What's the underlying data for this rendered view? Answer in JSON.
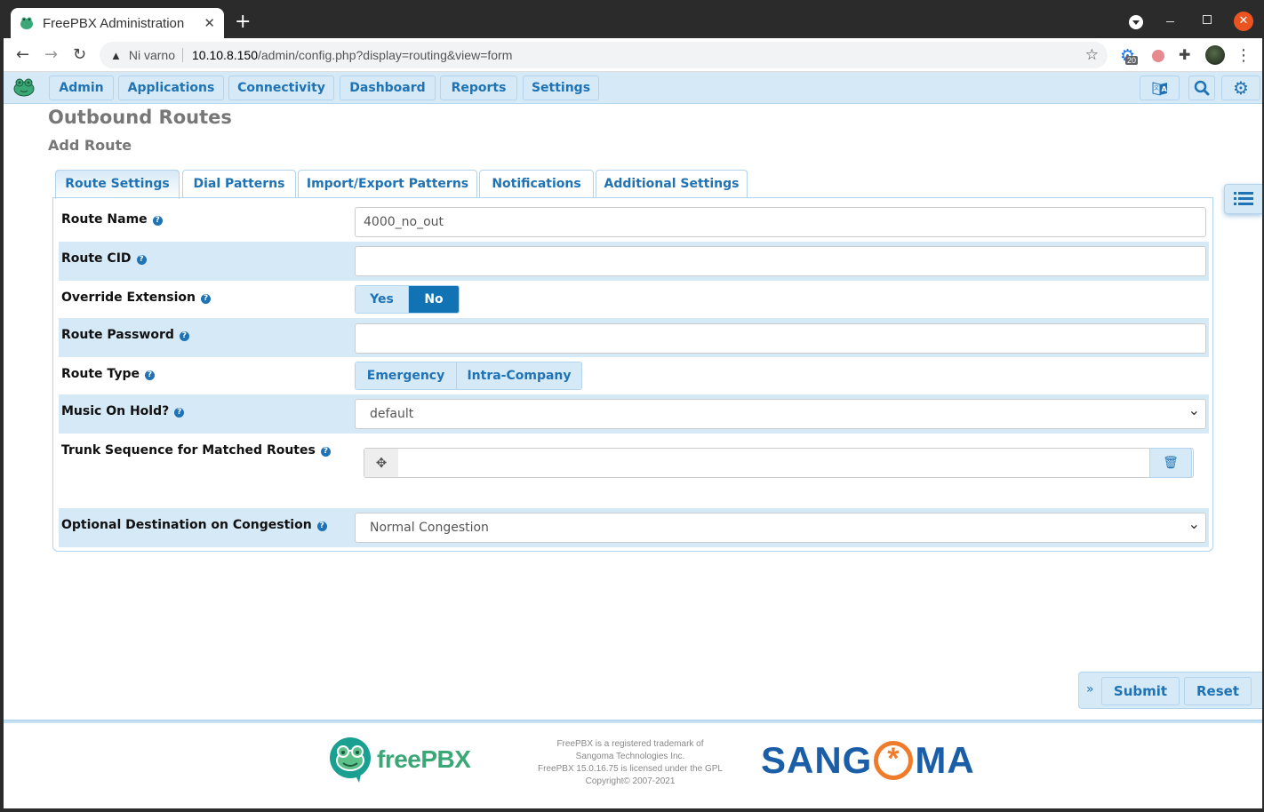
{
  "browser": {
    "tab_title": "FreePBX Administration",
    "security_label": "Ni varno",
    "url_host": "10.10.8.150",
    "url_path": "/admin/config.php?display=routing&view=form",
    "extension_badge": "20"
  },
  "nav": {
    "items": [
      {
        "label": "Admin"
      },
      {
        "label": "Applications"
      },
      {
        "label": "Connectivity"
      },
      {
        "label": "Dashboard"
      },
      {
        "label": "Reports"
      },
      {
        "label": "Settings"
      }
    ]
  },
  "page": {
    "title": "Outbound Routes",
    "subtitle": "Add Route"
  },
  "tabs": [
    {
      "label": "Route Settings",
      "active": true
    },
    {
      "label": "Dial Patterns"
    },
    {
      "label": "Import/Export Patterns"
    },
    {
      "label": "Notifications"
    },
    {
      "label": "Additional Settings"
    }
  ],
  "form": {
    "route_name": {
      "label": "Route Name",
      "value": "4000_no_out"
    },
    "route_cid": {
      "label": "Route CID",
      "value": ""
    },
    "override_extension": {
      "label": "Override Extension",
      "options": [
        "Yes",
        "No"
      ],
      "selected": "No"
    },
    "route_password": {
      "label": "Route Password",
      "value": ""
    },
    "route_type": {
      "label": "Route Type",
      "options": [
        "Emergency",
        "Intra-Company"
      ]
    },
    "music_on_hold": {
      "label": "Music On Hold?",
      "value": "default"
    },
    "trunk_sequence": {
      "label": "Trunk Sequence for Matched Routes",
      "value": ""
    },
    "congestion_destination": {
      "label": "Optional Destination on Congestion",
      "value": "Normal Congestion"
    }
  },
  "actions": {
    "submit": "Submit",
    "reset": "Reset"
  },
  "footer": {
    "logo_text": "freePBX",
    "line1": "FreePBX is a registered trademark of",
    "line2": "Sangoma Technologies Inc.",
    "line3": "FreePBX 15.0.16.75 is licensed under the GPL",
    "line4": "Copyright© 2007-2021",
    "sangoma_left": "SANG",
    "sangoma_right": "MA"
  },
  "colors": {
    "accent": "#1f73b4",
    "nav_bg": "#d6e9f7",
    "active_toggle": "#1273b4"
  }
}
